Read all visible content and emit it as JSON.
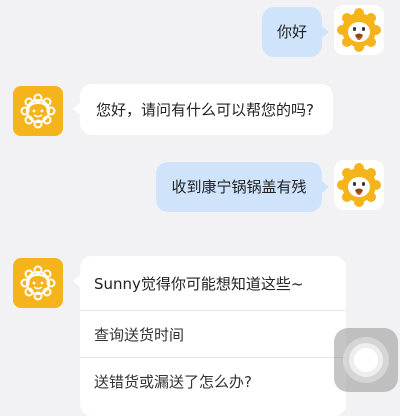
{
  "colors": {
    "background": "#f2f2f4",
    "user_bubble": "#cfe4fb",
    "bot_bubble": "#ffffff",
    "bot_avatar": "#f5b41b",
    "lion_mane": "#f5b41b",
    "lion_face": "#ffffff"
  },
  "messages": [
    {
      "from": "user",
      "text": "你好",
      "avatar": "suning-lion-icon"
    },
    {
      "from": "bot",
      "text": "您好，请问有什么可以帮您的吗?",
      "avatar": "bot-lion-headset-icon"
    },
    {
      "from": "user",
      "text": "收到康宁锅锅盖有残",
      "avatar": "suning-lion-icon"
    }
  ],
  "suggestion_card": {
    "title": "Sunny觉得你可能想知道这些~",
    "options": [
      "查询送货时间",
      "送错货或漏送了怎么办?"
    ]
  },
  "floating_button": {
    "icon": "assistive-touch-icon"
  }
}
